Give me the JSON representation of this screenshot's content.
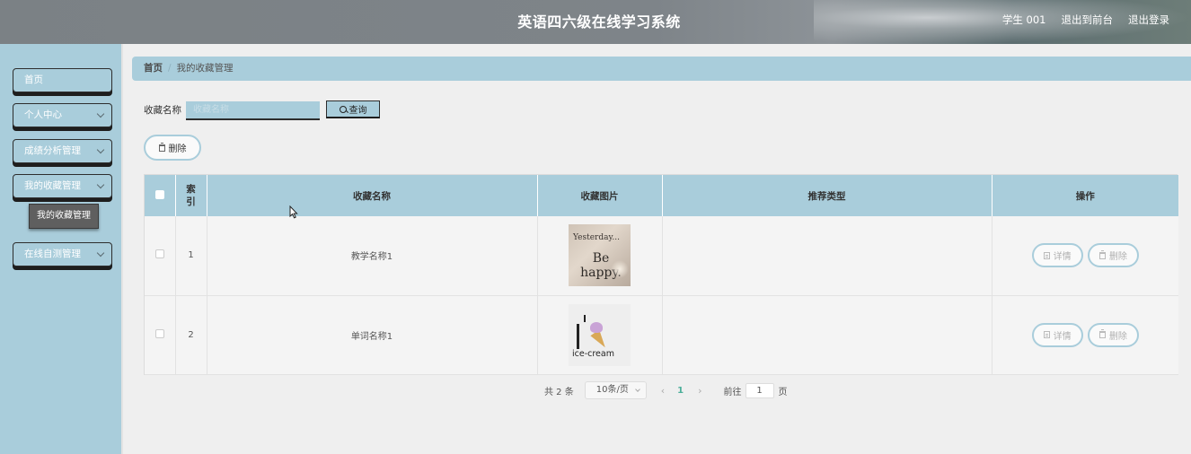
{
  "header": {
    "title": "英语四六级在线学习系统",
    "user": "学生 001",
    "back_to_front": "退出到前台",
    "logout": "退出登录"
  },
  "sidebar": {
    "items": [
      {
        "label": "首页"
      },
      {
        "label": "个人中心"
      },
      {
        "label": "成绩分析管理"
      },
      {
        "label": "我的收藏管理"
      },
      {
        "label": "在线自测管理"
      }
    ],
    "submenu_label": "我的收藏管理"
  },
  "breadcrumb": {
    "home": "首页",
    "current": "我的收藏管理"
  },
  "search": {
    "label": "收藏名称",
    "placeholder": "收藏名称",
    "button": "查询"
  },
  "actions": {
    "delete_label": "删除"
  },
  "table": {
    "headers": {
      "index": "索引",
      "name": "收藏名称",
      "image": "收藏图片",
      "type": "推荐类型",
      "ops": "操作"
    },
    "rows": [
      {
        "index": "1",
        "name": "教学名称1",
        "type": "",
        "image_text_a": "Yesterday...",
        "image_text_b": "Be happy."
      },
      {
        "index": "2",
        "name": "单词名称1",
        "type": "",
        "image_text_a": "ice-cream"
      }
    ],
    "detail_label": "详情",
    "row_delete_label": "删除"
  },
  "pagination": {
    "total": "共 2 条",
    "page_size": "10条/页",
    "prev": "‹",
    "current_page": "1",
    "next": "›",
    "goto_label": "前往",
    "goto_value": "1",
    "goto_unit": "页"
  }
}
